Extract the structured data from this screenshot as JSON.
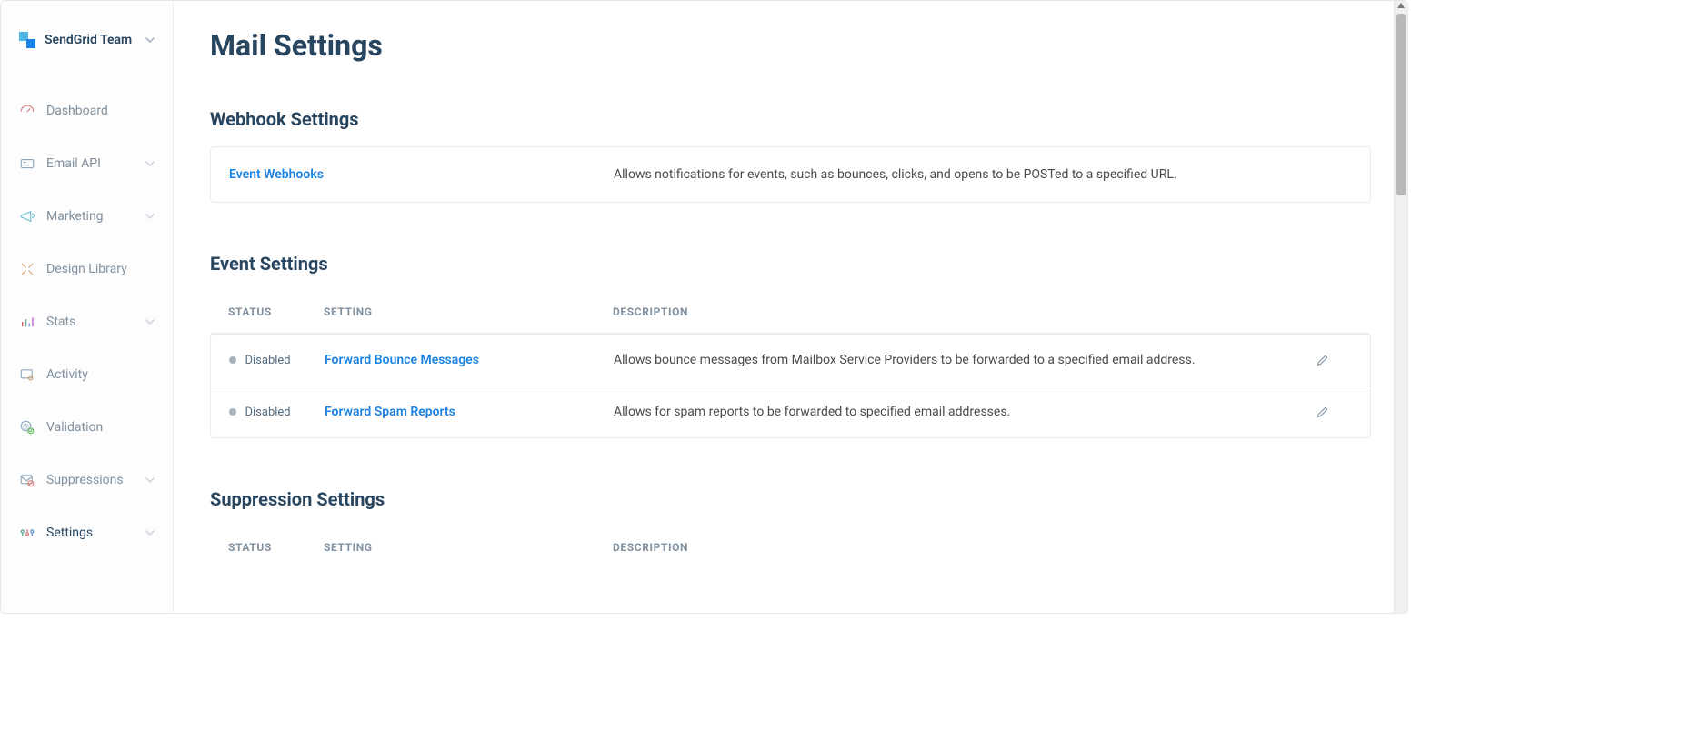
{
  "brand": {
    "name": "SendGrid Team"
  },
  "nav": {
    "items": [
      {
        "label": "Dashboard",
        "icon": "dashboard-icon",
        "chevron": false
      },
      {
        "label": "Email API",
        "icon": "email-api-icon",
        "chevron": true
      },
      {
        "label": "Marketing",
        "icon": "marketing-icon",
        "chevron": true
      },
      {
        "label": "Design Library",
        "icon": "design-icon",
        "chevron": false
      },
      {
        "label": "Stats",
        "icon": "stats-icon",
        "chevron": true
      },
      {
        "label": "Activity",
        "icon": "activity-icon",
        "chevron": false
      },
      {
        "label": "Validation",
        "icon": "validation-icon",
        "chevron": false
      },
      {
        "label": "Suppressions",
        "icon": "suppressions-icon",
        "chevron": true
      },
      {
        "label": "Settings",
        "icon": "settings-icon",
        "chevron": true
      }
    ]
  },
  "page": {
    "title": "Mail Settings"
  },
  "webhook": {
    "section_title": "Webhook Settings",
    "row": {
      "title": "Event Webhooks",
      "desc": "Allows notifications for events, such as bounces, clicks, and opens to be POSTed to a specified URL."
    }
  },
  "event": {
    "section_title": "Event Settings",
    "headers": {
      "status": "STATUS",
      "setting": "SETTING",
      "description": "DESCRIPTION"
    },
    "rows": [
      {
        "status": "Disabled",
        "setting": "Forward Bounce Messages",
        "desc": "Allows bounce messages from Mailbox Service Providers to be forwarded to a specified email address."
      },
      {
        "status": "Disabled",
        "setting": "Forward Spam Reports",
        "desc": "Allows for spam reports to be forwarded to specified email addresses."
      }
    ]
  },
  "suppression": {
    "section_title": "Suppression Settings",
    "headers": {
      "status": "STATUS",
      "setting": "SETTING",
      "description": "DESCRIPTION"
    }
  }
}
